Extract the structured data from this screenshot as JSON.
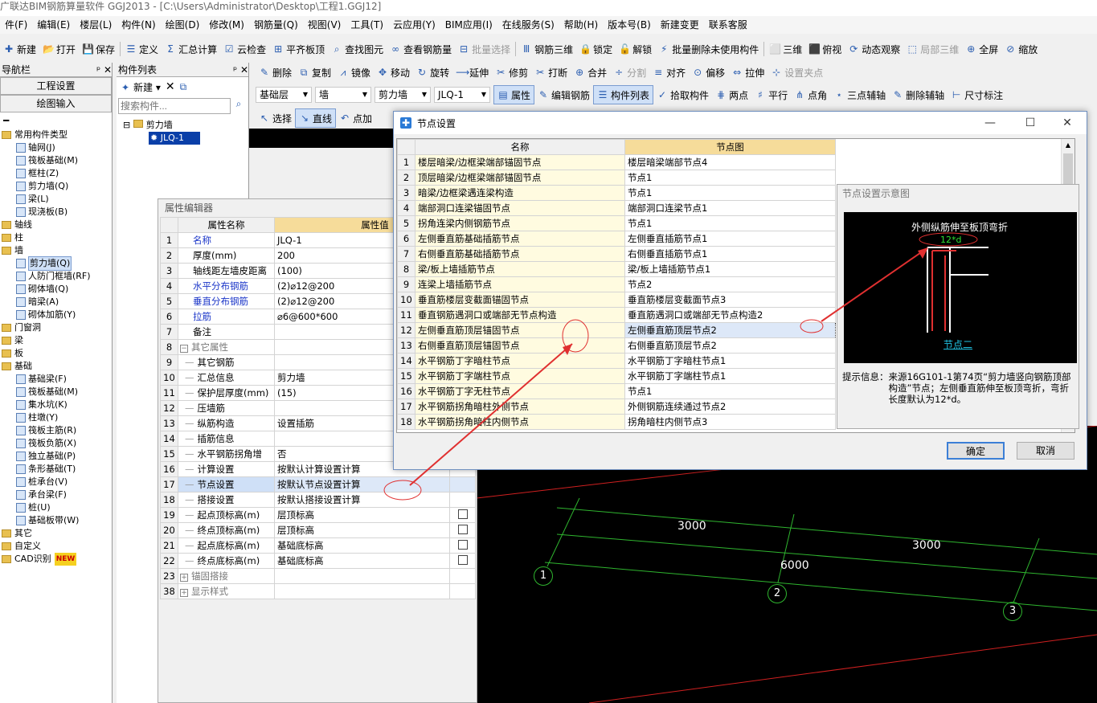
{
  "window": {
    "title": "广联达BIM钢筋算量软件 GGJ2013 - [C:\\Users\\Administrator\\Desktop\\工程1.GGJ12]"
  },
  "menu": [
    "件(F)",
    "编辑(E)",
    "楼层(L)",
    "构件(N)",
    "绘图(D)",
    "修改(M)",
    "钢筋量(Q)",
    "视图(V)",
    "工具(T)",
    "云应用(Y)",
    "BIM应用(I)",
    "在线服务(S)",
    "帮助(H)",
    "版本号(B)",
    "新建变更",
    "联系客服"
  ],
  "toolbar1": [
    "新建",
    "打开",
    "保存",
    "定义",
    "汇总计算",
    "云检查",
    "平齐板顶",
    "查找图元",
    "查看钢筋量",
    "批量选择",
    "钢筋三维",
    "锁定",
    "解锁",
    "批量删除未使用构件",
    "三维",
    "俯视",
    "动态观察",
    "局部三维",
    "全屏",
    "缩放"
  ],
  "toolbar2": [
    "删除",
    "复制",
    "镜像",
    "移动",
    "旋转",
    "延伸",
    "修剪",
    "打断",
    "合并",
    "分割",
    "对齐",
    "偏移",
    "拉伸",
    "设置夹点"
  ],
  "toolbar3": {
    "floor": "基础层",
    "type": "墙",
    "subtype": "剪力墙",
    "member": "JLQ-1",
    "buttons": [
      "属性",
      "编辑钢筋",
      "构件列表",
      "拾取构件",
      "两点",
      "平行",
      "点角",
      "三点辅轴",
      "删除辅轴",
      "尺寸标注"
    ]
  },
  "toolbar4": [
    "选择",
    "直线",
    "点加"
  ],
  "nav": {
    "title": "导航栏",
    "buttons": [
      "工程设置",
      "绘图输入"
    ],
    "tree": [
      {
        "label": "常用构件类型",
        "level": 0,
        "folder": true
      },
      {
        "label": "轴网(J)",
        "level": 1
      },
      {
        "label": "筏板基础(M)",
        "level": 1
      },
      {
        "label": "框柱(Z)",
        "level": 1
      },
      {
        "label": "剪力墙(Q)",
        "level": 1
      },
      {
        "label": "梁(L)",
        "level": 1
      },
      {
        "label": "现浇板(B)",
        "level": 1
      },
      {
        "label": "轴线",
        "level": 0,
        "folder": true
      },
      {
        "label": "柱",
        "level": 0,
        "folder": true
      },
      {
        "label": "墙",
        "level": 0,
        "folder": true
      },
      {
        "label": "剪力墙(Q)",
        "level": 1,
        "selected": true
      },
      {
        "label": "人防门框墙(RF)",
        "level": 1
      },
      {
        "label": "砌体墙(Q)",
        "level": 1
      },
      {
        "label": "暗梁(A)",
        "level": 1
      },
      {
        "label": "砌体加筋(Y)",
        "level": 1
      },
      {
        "label": "门窗洞",
        "level": 0,
        "folder": true
      },
      {
        "label": "梁",
        "level": 0,
        "folder": true
      },
      {
        "label": "板",
        "level": 0,
        "folder": true
      },
      {
        "label": "基础",
        "level": 0,
        "folder": true
      },
      {
        "label": "基础梁(F)",
        "level": 1
      },
      {
        "label": "筏板基础(M)",
        "level": 1
      },
      {
        "label": "集水坑(K)",
        "level": 1
      },
      {
        "label": "柱墩(Y)",
        "level": 1
      },
      {
        "label": "筏板主筋(R)",
        "level": 1
      },
      {
        "label": "筏板负筋(X)",
        "level": 1
      },
      {
        "label": "独立基础(P)",
        "level": 1
      },
      {
        "label": "条形基础(T)",
        "level": 1
      },
      {
        "label": "桩承台(V)",
        "level": 1
      },
      {
        "label": "承台梁(F)",
        "level": 1
      },
      {
        "label": "桩(U)",
        "level": 1
      },
      {
        "label": "基础板带(W)",
        "level": 1
      },
      {
        "label": "其它",
        "level": 0,
        "folder": true
      },
      {
        "label": "自定义",
        "level": 0,
        "folder": true
      },
      {
        "label": "CAD识别",
        "level": 0,
        "folder": true,
        "badge": "NEW"
      }
    ]
  },
  "clist": {
    "title": "构件列表",
    "new_label": "新建",
    "search_placeholder": "搜索构件...",
    "root": "剪力墙",
    "item": "JLQ-1"
  },
  "prop_editor": {
    "title": "属性编辑器",
    "col_name": "属性名称",
    "col_value": "属性值",
    "rows": [
      {
        "n": "1",
        "name": "名称",
        "value": "JLQ-1",
        "blue": true,
        "indent": 0
      },
      {
        "n": "2",
        "name": "厚度(mm)",
        "value": "200",
        "indent": 0
      },
      {
        "n": "3",
        "name": "轴线距左墙皮距离",
        "value": "(100)",
        "indent": 0
      },
      {
        "n": "4",
        "name": "水平分布钢筋",
        "value": "(2)⌀12@200",
        "blue": true,
        "indent": 0
      },
      {
        "n": "5",
        "name": "垂直分布钢筋",
        "value": "(2)⌀12@200",
        "blue": true,
        "indent": 0
      },
      {
        "n": "6",
        "name": "拉筋",
        "value": "⌀6@600*600",
        "blue": true,
        "indent": 0
      },
      {
        "n": "7",
        "name": "备注",
        "value": "",
        "indent": 0
      },
      {
        "n": "8",
        "name": "其它属性",
        "value": "",
        "grey": true,
        "indent": 0,
        "group": "−"
      },
      {
        "n": "9",
        "name": "其它钢筋",
        "value": "",
        "indent": 1
      },
      {
        "n": "10",
        "name": "汇总信息",
        "value": "剪力墙",
        "indent": 1
      },
      {
        "n": "11",
        "name": "保护层厚度(mm)",
        "value": "(15)",
        "indent": 1
      },
      {
        "n": "12",
        "name": "压墙筋",
        "value": "",
        "indent": 1
      },
      {
        "n": "13",
        "name": "纵筋构造",
        "value": "设置插筋",
        "indent": 1
      },
      {
        "n": "14",
        "name": "插筋信息",
        "value": "",
        "indent": 1
      },
      {
        "n": "15",
        "name": "水平钢筋拐角增",
        "value": "否",
        "indent": 1
      },
      {
        "n": "16",
        "name": "计算设置",
        "value": "按默认计算设置计算",
        "indent": 1
      },
      {
        "n": "17",
        "name": "节点设置",
        "value": "按默认节点设置计算",
        "indent": 1,
        "selected": true
      },
      {
        "n": "18",
        "name": "搭接设置",
        "value": "按默认搭接设置计算",
        "indent": 1
      },
      {
        "n": "19",
        "name": "起点顶标高(m)",
        "value": "层顶标高",
        "indent": 1,
        "check": true
      },
      {
        "n": "20",
        "name": "终点顶标高(m)",
        "value": "层顶标高",
        "indent": 1,
        "check": true
      },
      {
        "n": "21",
        "name": "起点底标高(m)",
        "value": "基础底标高",
        "indent": 1,
        "check": true
      },
      {
        "n": "22",
        "name": "终点底标高(m)",
        "value": "基础底标高",
        "indent": 1,
        "check": true
      },
      {
        "n": "23",
        "name": "锚固搭接",
        "value": "",
        "grey": true,
        "indent": 0,
        "group": "+"
      },
      {
        "n": "38",
        "name": "显示样式",
        "value": "",
        "grey": true,
        "indent": 0,
        "group": "+"
      }
    ]
  },
  "node_dialog": {
    "title": "节点设置",
    "col_name": "名称",
    "col_node": "节点图",
    "rows": [
      {
        "n": "1",
        "name": "楼层暗梁/边框梁端部锚固节点",
        "node": "楼层暗梁端部节点4"
      },
      {
        "n": "2",
        "name": "顶层暗梁/边框梁端部锚固节点",
        "node": "节点1"
      },
      {
        "n": "3",
        "name": "暗梁/边框梁遇连梁构造",
        "node": "节点1"
      },
      {
        "n": "4",
        "name": "端部洞口连梁锚固节点",
        "node": "端部洞口连梁节点1"
      },
      {
        "n": "5",
        "name": "拐角连梁内侧钢筋节点",
        "node": "节点1"
      },
      {
        "n": "6",
        "name": "左侧垂直筋基础插筋节点",
        "node": "左侧垂直插筋节点1"
      },
      {
        "n": "7",
        "name": "右侧垂直筋基础插筋节点",
        "node": "右侧垂直插筋节点1"
      },
      {
        "n": "8",
        "name": "梁/板上墙插筋节点",
        "node": "梁/板上墙插筋节点1"
      },
      {
        "n": "9",
        "name": "连梁上墙插筋节点",
        "node": "节点2"
      },
      {
        "n": "10",
        "name": "垂直筋楼层变截面锚固节点",
        "node": "垂直筋楼层变截面节点3"
      },
      {
        "n": "11",
        "name": "垂直钢筋遇洞口或端部无节点构造",
        "node": "垂直筋遇洞口或端部无节点构造2"
      },
      {
        "n": "12",
        "name": "左侧垂直筋顶层锚固节点",
        "node": "左侧垂直筋顶层节点2",
        "selected": true
      },
      {
        "n": "13",
        "name": "右侧垂直筋顶层锚固节点",
        "node": "右侧垂直筋顶层节点2"
      },
      {
        "n": "14",
        "name": "水平钢筋丁字暗柱节点",
        "node": "水平钢筋丁字暗柱节点1"
      },
      {
        "n": "15",
        "name": "水平钢筋丁字端柱节点",
        "node": "水平钢筋丁字端柱节点1"
      },
      {
        "n": "16",
        "name": "水平钢筋丁字无柱节点",
        "node": "节点1"
      },
      {
        "n": "17",
        "name": "水平钢筋拐角暗柱外侧节点",
        "node": "外侧钢筋连续通过节点2"
      },
      {
        "n": "18",
        "name": "水平钢筋拐角暗柱内侧节点",
        "node": "拐角暗柱内侧节点3"
      }
    ],
    "preview": {
      "title": "节点设置示意图",
      "caption_top": "外侧纵筋伸至板顶弯折",
      "dim": "12*d",
      "caption_bottom": "节点二",
      "hint_label": "提示信息：",
      "hint_text": "来源16G101-1第74页“剪力墙竖向钢筋顶部构造”节点；左侧垂直筋伸至板顶弯折，弯折长度默认为12*d。"
    },
    "ok": "确定",
    "cancel": "取消"
  },
  "canvas": {
    "dims": [
      "3000",
      "3000",
      "6000"
    ],
    "axes": [
      "1",
      "2",
      "3"
    ]
  }
}
